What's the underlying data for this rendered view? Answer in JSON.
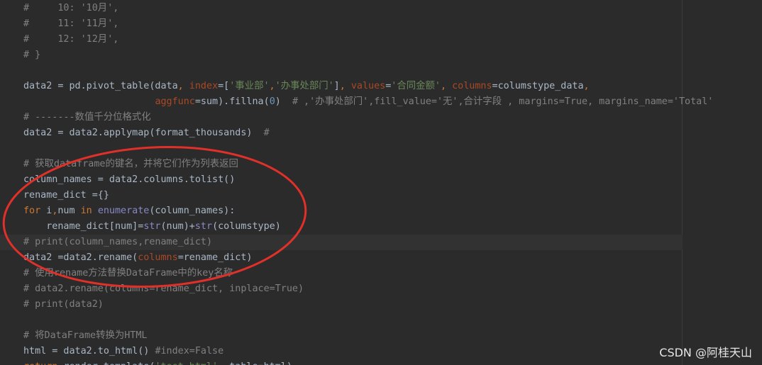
{
  "editor": {
    "lines": [
      [
        [
          "c-comment",
          "#     10: '10月',"
        ]
      ],
      [
        [
          "c-comment",
          "#     11: '11月',"
        ]
      ],
      [
        [
          "c-comment",
          "#     12: '12月',"
        ]
      ],
      [
        [
          "c-comment",
          "# }"
        ]
      ],
      [],
      [
        [
          "",
          "data2 = pd.pivot_table(data"
        ],
        [
          "c-punct",
          ", "
        ],
        [
          "c-param",
          "index"
        ],
        [
          "",
          "=["
        ],
        [
          "c-string",
          "'事业部'"
        ],
        [
          "c-punct",
          ","
        ],
        [
          "c-string",
          "'办事处部门'"
        ],
        [
          "",
          "]"
        ],
        [
          "c-punct",
          ", "
        ],
        [
          "c-param",
          "values"
        ],
        [
          "",
          "="
        ],
        [
          "c-string",
          "'合同金额'"
        ],
        [
          "c-punct",
          ", "
        ],
        [
          "c-param",
          "columns"
        ],
        [
          "",
          "=columstype_data"
        ],
        [
          "c-punct",
          ","
        ]
      ],
      [
        [
          "",
          "                       "
        ],
        [
          "c-param",
          "aggfunc"
        ],
        [
          "",
          "=sum).fillna("
        ],
        [
          "c-num",
          "0"
        ],
        [
          "",
          ")  "
        ],
        [
          "c-comment",
          "# ,'办事处部门',fill_value='无',合计字段 , margins=True, margins_name='Total'"
        ]
      ],
      [
        [
          "c-comment",
          "# -------数值千分位格式化"
        ]
      ],
      [
        [
          "",
          "data2 = data2.applymap(format_thousands)  "
        ],
        [
          "c-comment",
          "#"
        ]
      ],
      [],
      [
        [
          "c-comment",
          "# 获取dataframe的键名，并将它们作为列表返回"
        ]
      ],
      [
        [
          "",
          "column_names = data2.columns.tolist()"
        ]
      ],
      [
        [
          "",
          "rename_dict ={}"
        ]
      ],
      [
        [
          "c-kw",
          "for "
        ],
        [
          "",
          "i"
        ],
        [
          "c-punct",
          ","
        ],
        [
          "",
          "num "
        ],
        [
          "c-kw",
          "in "
        ],
        [
          "c-builtin",
          "enumerate"
        ],
        [
          "",
          "(column_names):"
        ]
      ],
      [
        [
          "",
          "    rename_dict[num]="
        ],
        [
          "c-builtin",
          "str"
        ],
        [
          "",
          "(num)+"
        ],
        [
          "c-builtin",
          "str"
        ],
        [
          "",
          "(columstype)"
        ]
      ],
      [
        [
          "c-comment",
          "# print(column_names,rename_dict)"
        ]
      ],
      [
        [
          "",
          "data2 =data2.rename("
        ],
        [
          "c-param",
          "columns"
        ],
        [
          "",
          "=rename_dict)"
        ]
      ],
      [
        [
          "c-comment",
          "# 使用rename方法替换DataFrame中的key名称"
        ]
      ],
      [
        [
          "c-comment",
          "# data2.rename(columns=rename_dict, inplace=True)"
        ]
      ],
      [
        [
          "c-comment",
          "# print(data2)"
        ]
      ],
      [],
      [
        [
          "c-comment",
          "# 将DataFrame转换为HTML"
        ]
      ],
      [
        [
          "",
          "html = data2.to_html() "
        ],
        [
          "c-comment",
          "#index=False"
        ]
      ],
      [
        [
          "c-kw",
          "return "
        ],
        [
          "",
          "render_template("
        ],
        [
          "c-string",
          "'test.html'"
        ],
        [
          "c-punct",
          ", "
        ],
        [
          "",
          "table=html)"
        ]
      ]
    ]
  },
  "watermark": "CSDN @阿桂天山",
  "colors": {
    "background": "#2b2b2b",
    "current_line": "#323232",
    "annotation_circle": "#e0302a"
  }
}
